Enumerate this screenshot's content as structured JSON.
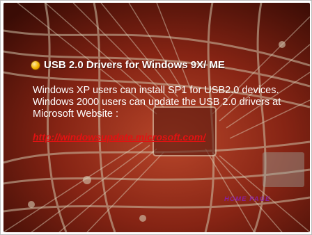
{
  "heading": {
    "text": "USB 2.0 Drivers for Windows 9X/ ME",
    "bullet_icon": "orange-orb-icon"
  },
  "body": {
    "lines": [
      "Windows XP users can install SP1 for USB2.0 devices.",
      "Windows 2000 users can update the USB 2.0 drivers at",
      "Microsoft Website :"
    ]
  },
  "link": {
    "text": "http://windowsupdate.microsoft.com/"
  },
  "footer": {
    "homepage_label": "HOME PAGE"
  },
  "colors": {
    "background_dark": "#3a0c05",
    "background_red": "#a8301e",
    "trace_color": "#cfc2a8",
    "link_red": "#e21212",
    "homepage_purple": "#8a1ea8",
    "text_white": "#ffffff"
  }
}
